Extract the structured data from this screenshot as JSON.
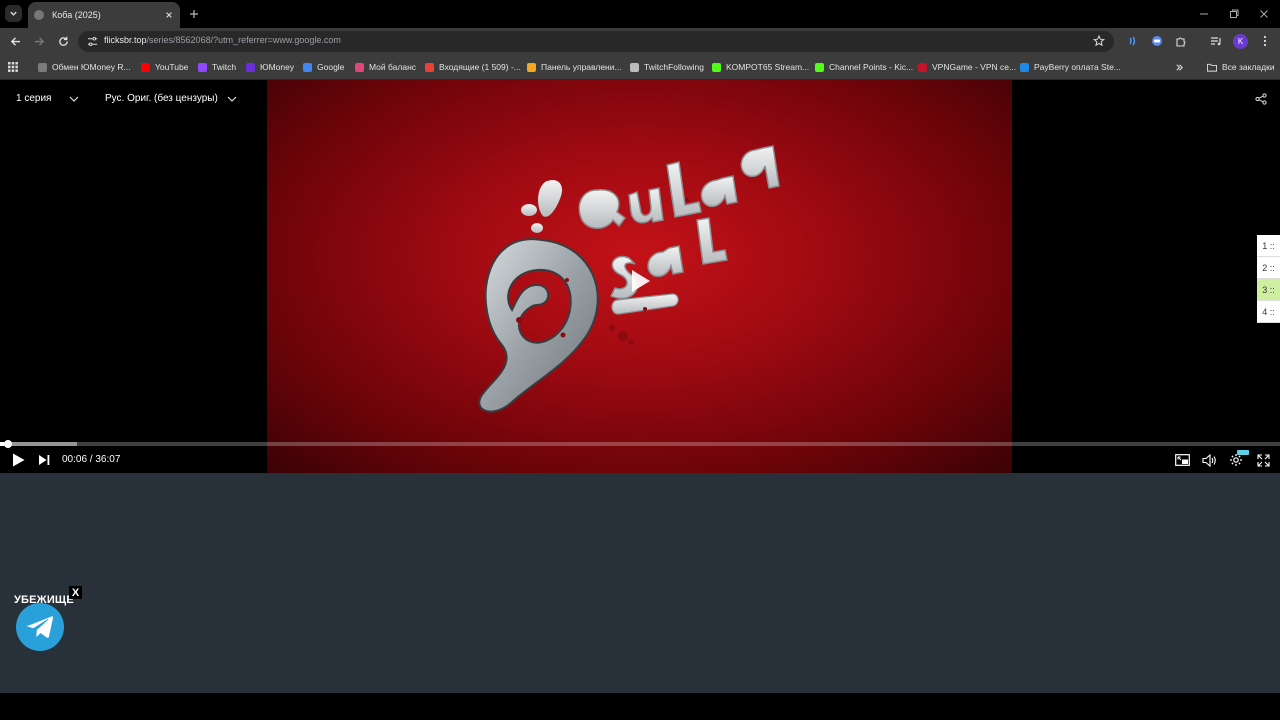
{
  "browser": {
    "tab_title": "Коба (2025)",
    "url_host": "flicksbr.top",
    "url_path": "/series/8562068/?utm_referrer=www.google.com",
    "profile_initial": "K",
    "bookmarks": [
      {
        "label": "Обмен ЮMoney R...",
        "color": "#7b7b7b"
      },
      {
        "label": "YouTube",
        "color": "#ff0000"
      },
      {
        "label": "Twitch",
        "color": "#9146ff"
      },
      {
        "label": "ЮMoney",
        "color": "#6b2fd9"
      },
      {
        "label": "Google",
        "color": "#4285f4"
      },
      {
        "label": "Мой баланс",
        "color": "#e0457b"
      },
      {
        "label": "Входящие (1 509) -...",
        "color": "#ea4335"
      },
      {
        "label": "Панель управлени...",
        "color": "#f5a623"
      },
      {
        "label": "TwitchFollowing",
        "color": "#bbbbbb"
      },
      {
        "label": "KOMPOT65 Stream...",
        "color": "#53fc18"
      },
      {
        "label": "Channel Points - Kic...",
        "color": "#53fc18"
      },
      {
        "label": "VPNGame - VPN се...",
        "color": "#c0152a"
      },
      {
        "label": "PayBerry оплата Ste...",
        "color": "#1e88e5"
      }
    ],
    "all_bookmarks_label": "Все закладки"
  },
  "player": {
    "episode_select": "1 серия",
    "audio_select": "Рус. Ориг. (без цензуры)",
    "side_items": [
      "1 ::",
      "2 ::",
      "3 ::",
      "4 ::"
    ],
    "active_side_item": 2,
    "timecode": "00:06 / 36:07",
    "progress": {
      "played": 0.003,
      "buffered": 0.06
    }
  },
  "promo": {
    "label": "УБЕЖИЩЕ",
    "close": "X"
  }
}
